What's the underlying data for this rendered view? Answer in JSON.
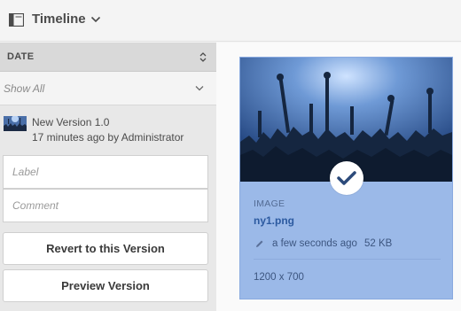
{
  "header": {
    "title": "Timeline",
    "rail_icon": "rail-toggle-icon",
    "chevron_icon": "chevron-down-icon"
  },
  "rail": {
    "sort_label": "DATE",
    "filter": {
      "selected": "Show All",
      "options_visible": [
        "Show All"
      ]
    },
    "version": {
      "name": "New Version 1.0",
      "meta": "17 minutes ago by Administrator"
    },
    "label_field": {
      "value": "",
      "placeholder": "Label"
    },
    "comment_field": {
      "value": "",
      "placeholder": "Comment"
    },
    "revert_button": "Revert to this Version",
    "preview_button": "Preview Version"
  },
  "card": {
    "type": "IMAGE",
    "name": "ny1.png",
    "modified": "a few seconds ago",
    "size": "52 KB",
    "dimensions": "1200 x 700",
    "selected": true
  },
  "colors": {
    "card_bg": "#9bb9e8",
    "card_title": "#2c5aa0",
    "rail_bg": "#e8e8e8",
    "checkmark": "#2c4a7a"
  }
}
